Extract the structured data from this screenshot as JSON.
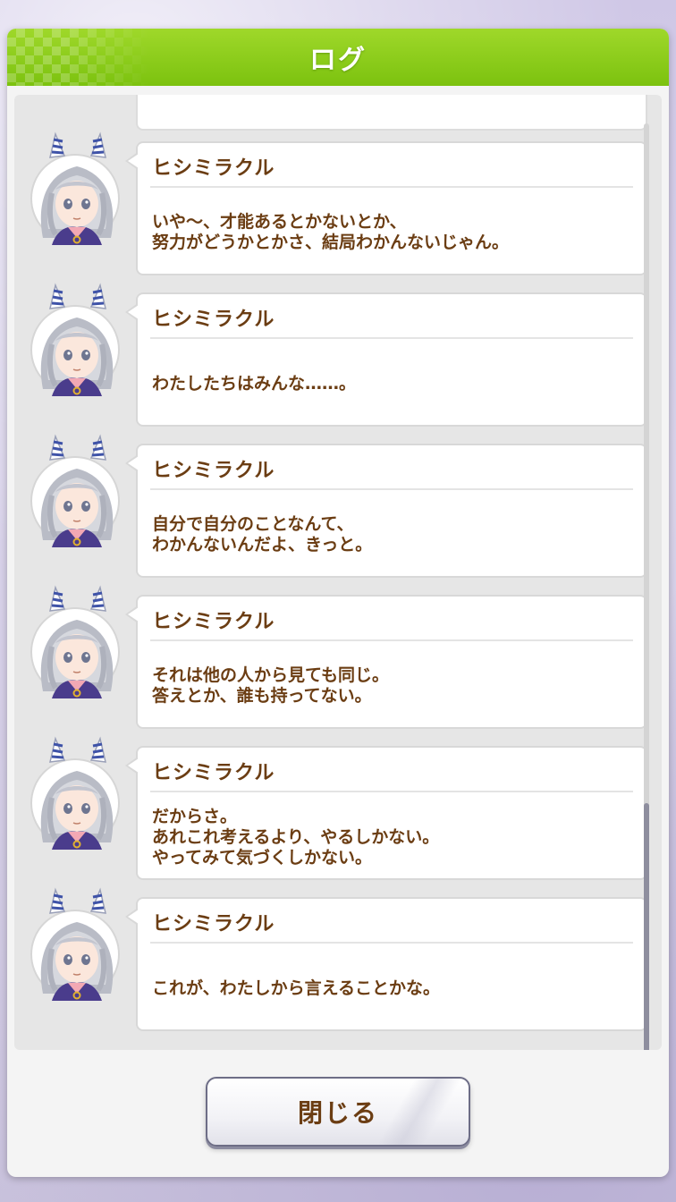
{
  "dialog": {
    "title": "ログ",
    "close_label": "閉じる"
  },
  "entries": [
    {
      "speaker": "ヒシミラクル",
      "lines": [
        "いや～、才能あるとかないとか、",
        "努力がどうかとかさ、結局わかんないじゃん。"
      ]
    },
    {
      "speaker": "ヒシミラクル",
      "lines": [
        "わたしたちはみんな……。"
      ]
    },
    {
      "speaker": "ヒシミラクル",
      "lines": [
        "自分で自分のことなんて、",
        "わかんないんだよ、きっと。"
      ]
    },
    {
      "speaker": "ヒシミラクル",
      "lines": [
        "それは他の人から見ても同じ。",
        "答えとか、誰も持ってない。"
      ]
    },
    {
      "speaker": "ヒシミラクル",
      "lines": [
        "だからさ。",
        "あれこれ考えるより、やるしかない。",
        "やってみて気づくしかない。"
      ]
    },
    {
      "speaker": "ヒシミラクル",
      "lines": [
        "これが、わたしから言えることかな。"
      ]
    }
  ],
  "colors": {
    "header_green": "#8ccf1c",
    "text_brown": "#6b3d13"
  }
}
